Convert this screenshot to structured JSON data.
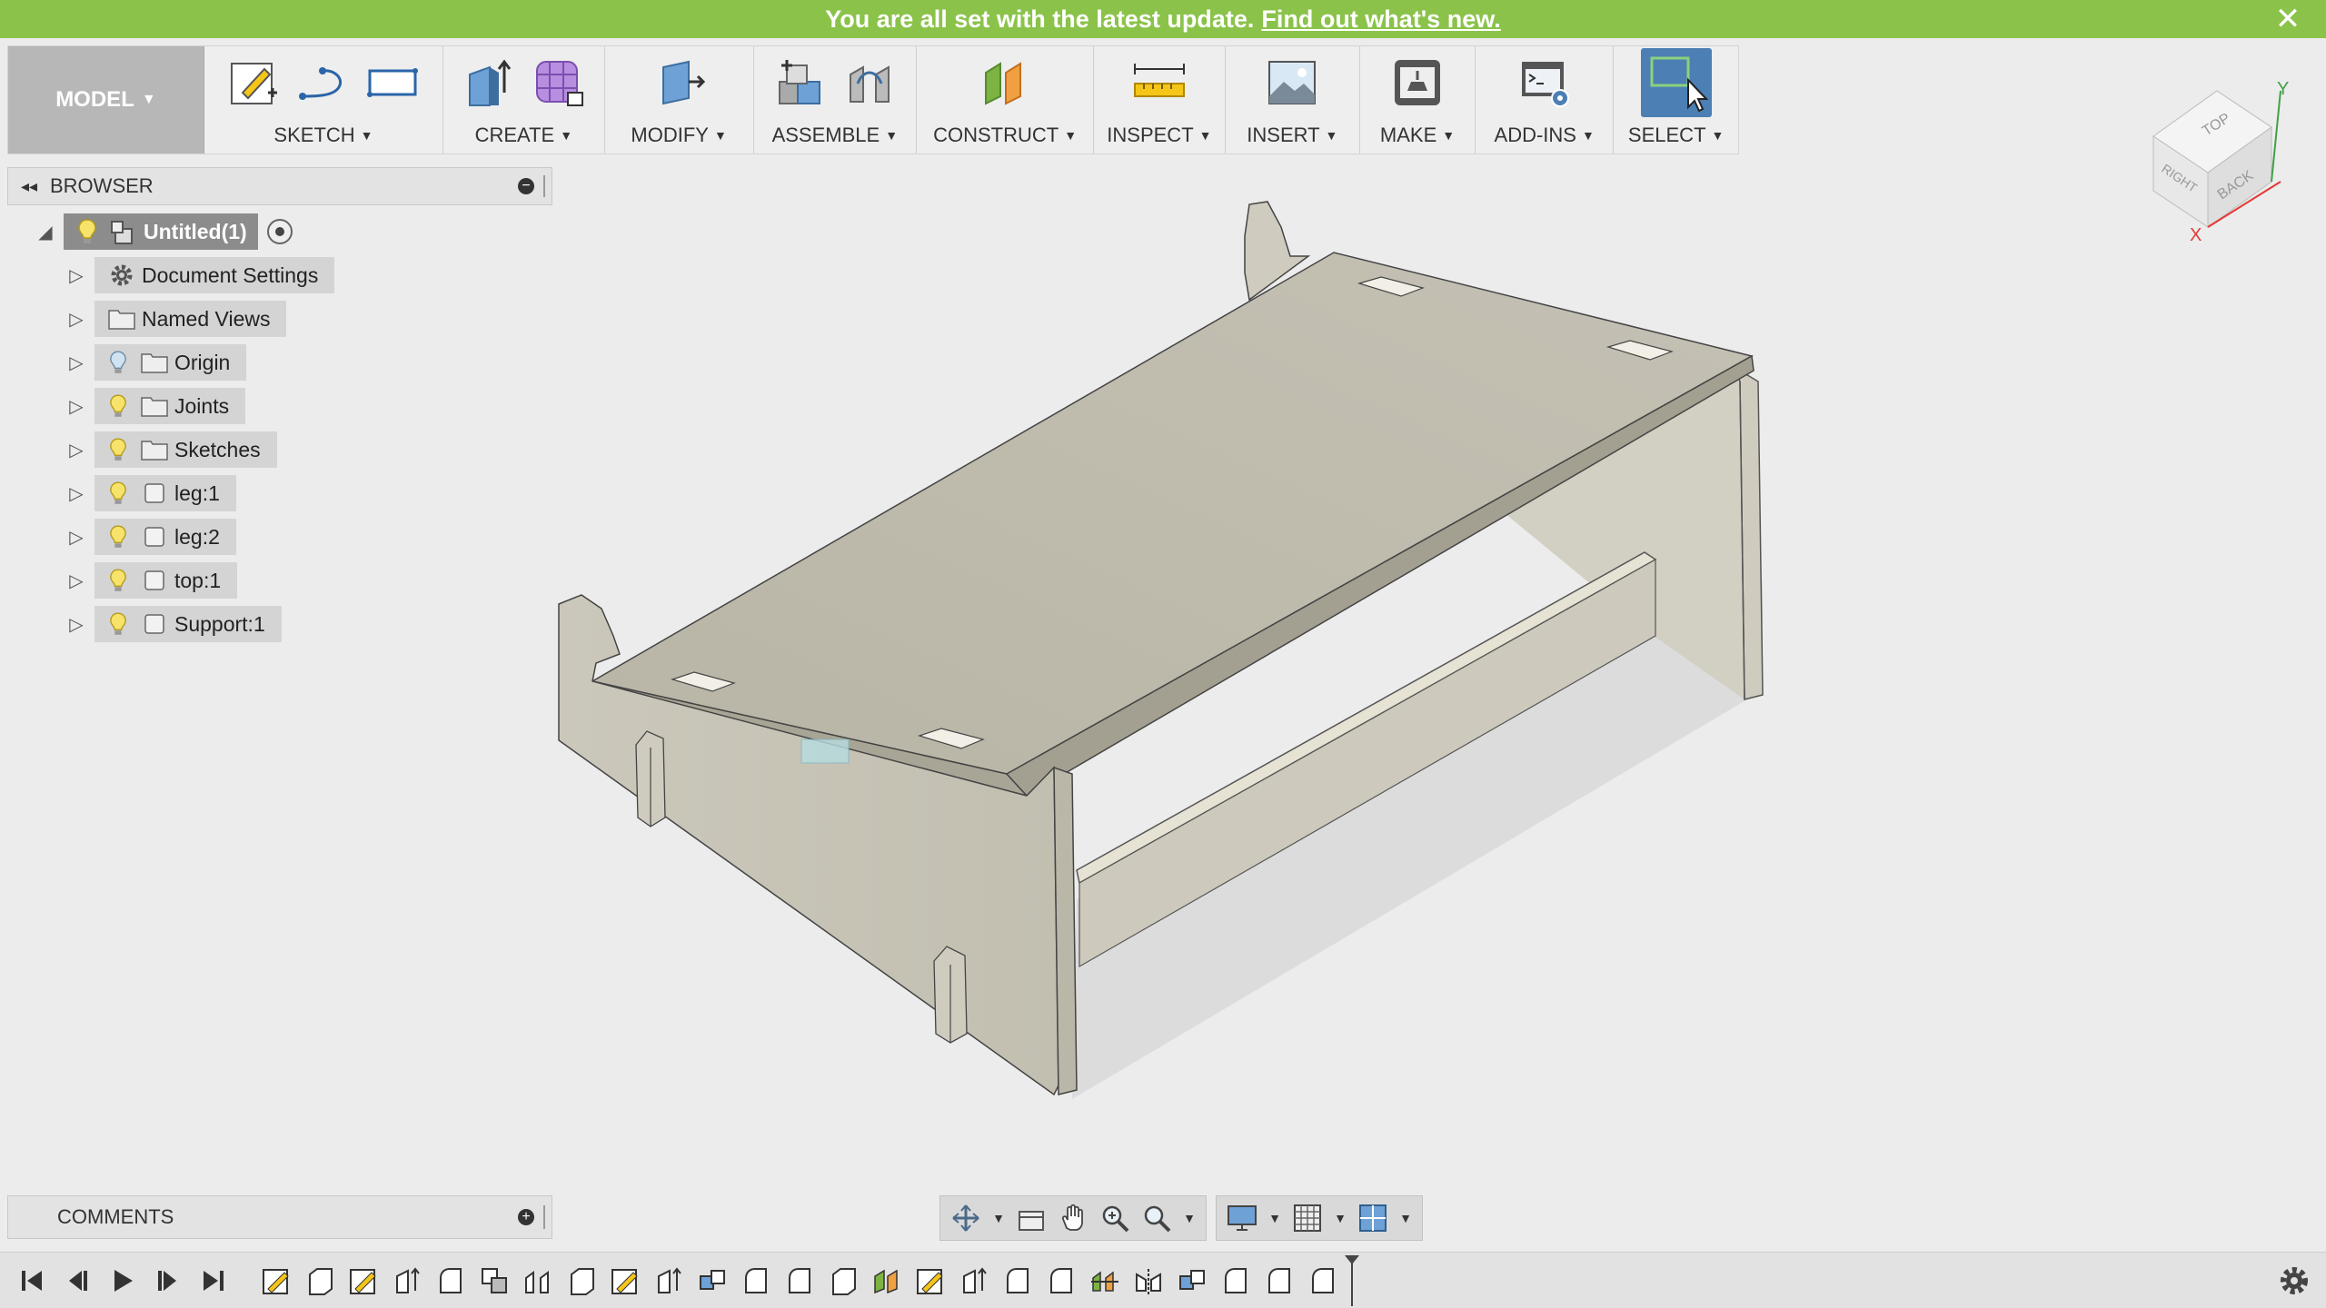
{
  "banner": {
    "message": "You are all set with the latest update.",
    "link": "Find out what's new.",
    "close": "✕"
  },
  "toolbar": {
    "workspace": "MODEL",
    "groups": [
      {
        "label": "SKETCH"
      },
      {
        "label": "CREATE"
      },
      {
        "label": "MODIFY"
      },
      {
        "label": "ASSEMBLE"
      },
      {
        "label": "CONSTRUCT"
      },
      {
        "label": "INSPECT"
      },
      {
        "label": "INSERT"
      },
      {
        "label": "MAKE"
      },
      {
        "label": "ADD-INS"
      },
      {
        "label": "SELECT"
      }
    ]
  },
  "browser": {
    "title": "BROWSER",
    "items": [
      {
        "label": "Untitled(1)"
      },
      {
        "label": "Document Settings"
      },
      {
        "label": "Named Views"
      },
      {
        "label": "Origin"
      },
      {
        "label": "Joints"
      },
      {
        "label": "Sketches"
      },
      {
        "label": "leg:1"
      },
      {
        "label": "leg:2"
      },
      {
        "label": "top:1"
      },
      {
        "label": "Support:1"
      }
    ]
  },
  "comments": {
    "title": "COMMENTS"
  },
  "viewcube": {
    "top": "TOP",
    "right": "RIGHT",
    "back": "BACK",
    "axis_x": "X",
    "axis_y": "Y"
  },
  "colors": {
    "banner": "#8bc34a",
    "model_face": "#c9c6b9",
    "model_top": "#bdb9ab",
    "select_active": "#4c7fb4",
    "axis_x": "#e53935",
    "axis_y": "#43a047"
  }
}
